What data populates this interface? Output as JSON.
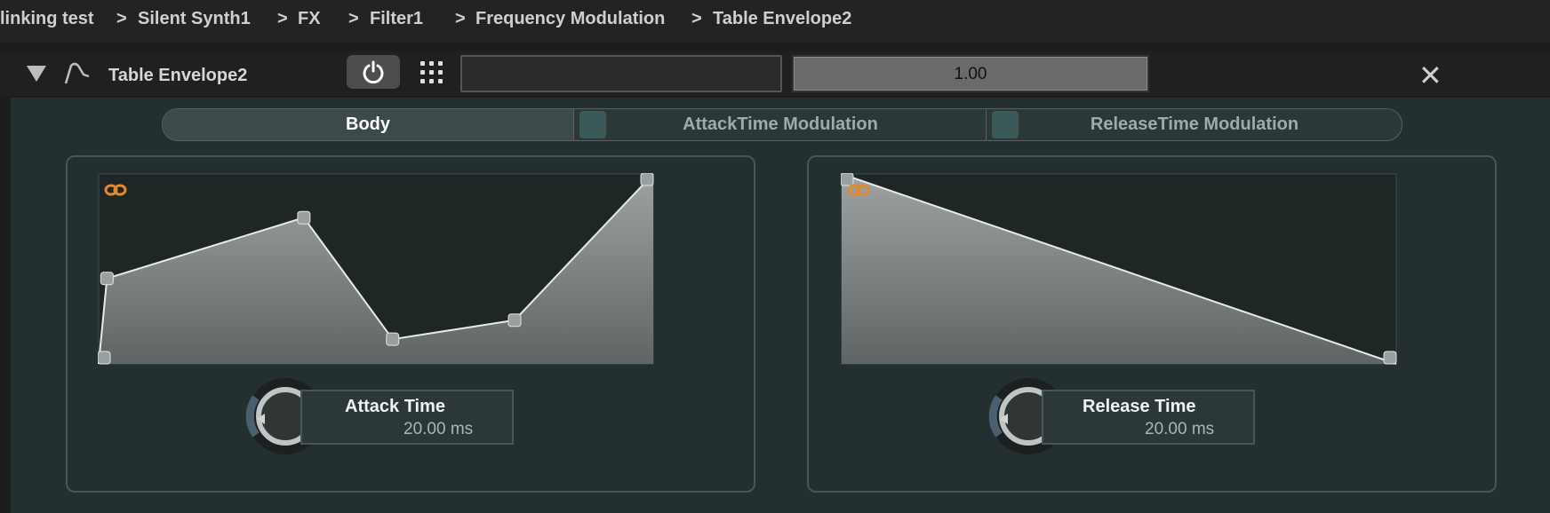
{
  "breadcrumbs": [
    "linking test",
    "Silent Synth1",
    "FX",
    "Filter1",
    "Frequency Modulation",
    "Table Envelope2"
  ],
  "breadcrumb_separator": ">",
  "header": {
    "title": "Table Envelope2",
    "intensity_value": "1.00",
    "input_value": ""
  },
  "tabs": [
    "Body",
    "AttackTime Modulation",
    "ReleaseTime Modulation"
  ],
  "attack": {
    "label": "Attack Time",
    "value": "20.00 ms",
    "table_points": [
      [
        0,
        0
      ],
      [
        0.015,
        0.45
      ],
      [
        0.37,
        0.77
      ],
      [
        0.53,
        0.13
      ],
      [
        0.75,
        0.23
      ],
      [
        1,
        1
      ]
    ]
  },
  "release": {
    "label": "Release Time",
    "value": "20.00 ms",
    "table_points": [
      [
        0,
        1
      ],
      [
        1,
        0
      ]
    ]
  },
  "colors": {
    "panel": "#243030",
    "accent_link": "#e08a2a",
    "tab_square": "#3b5958"
  }
}
